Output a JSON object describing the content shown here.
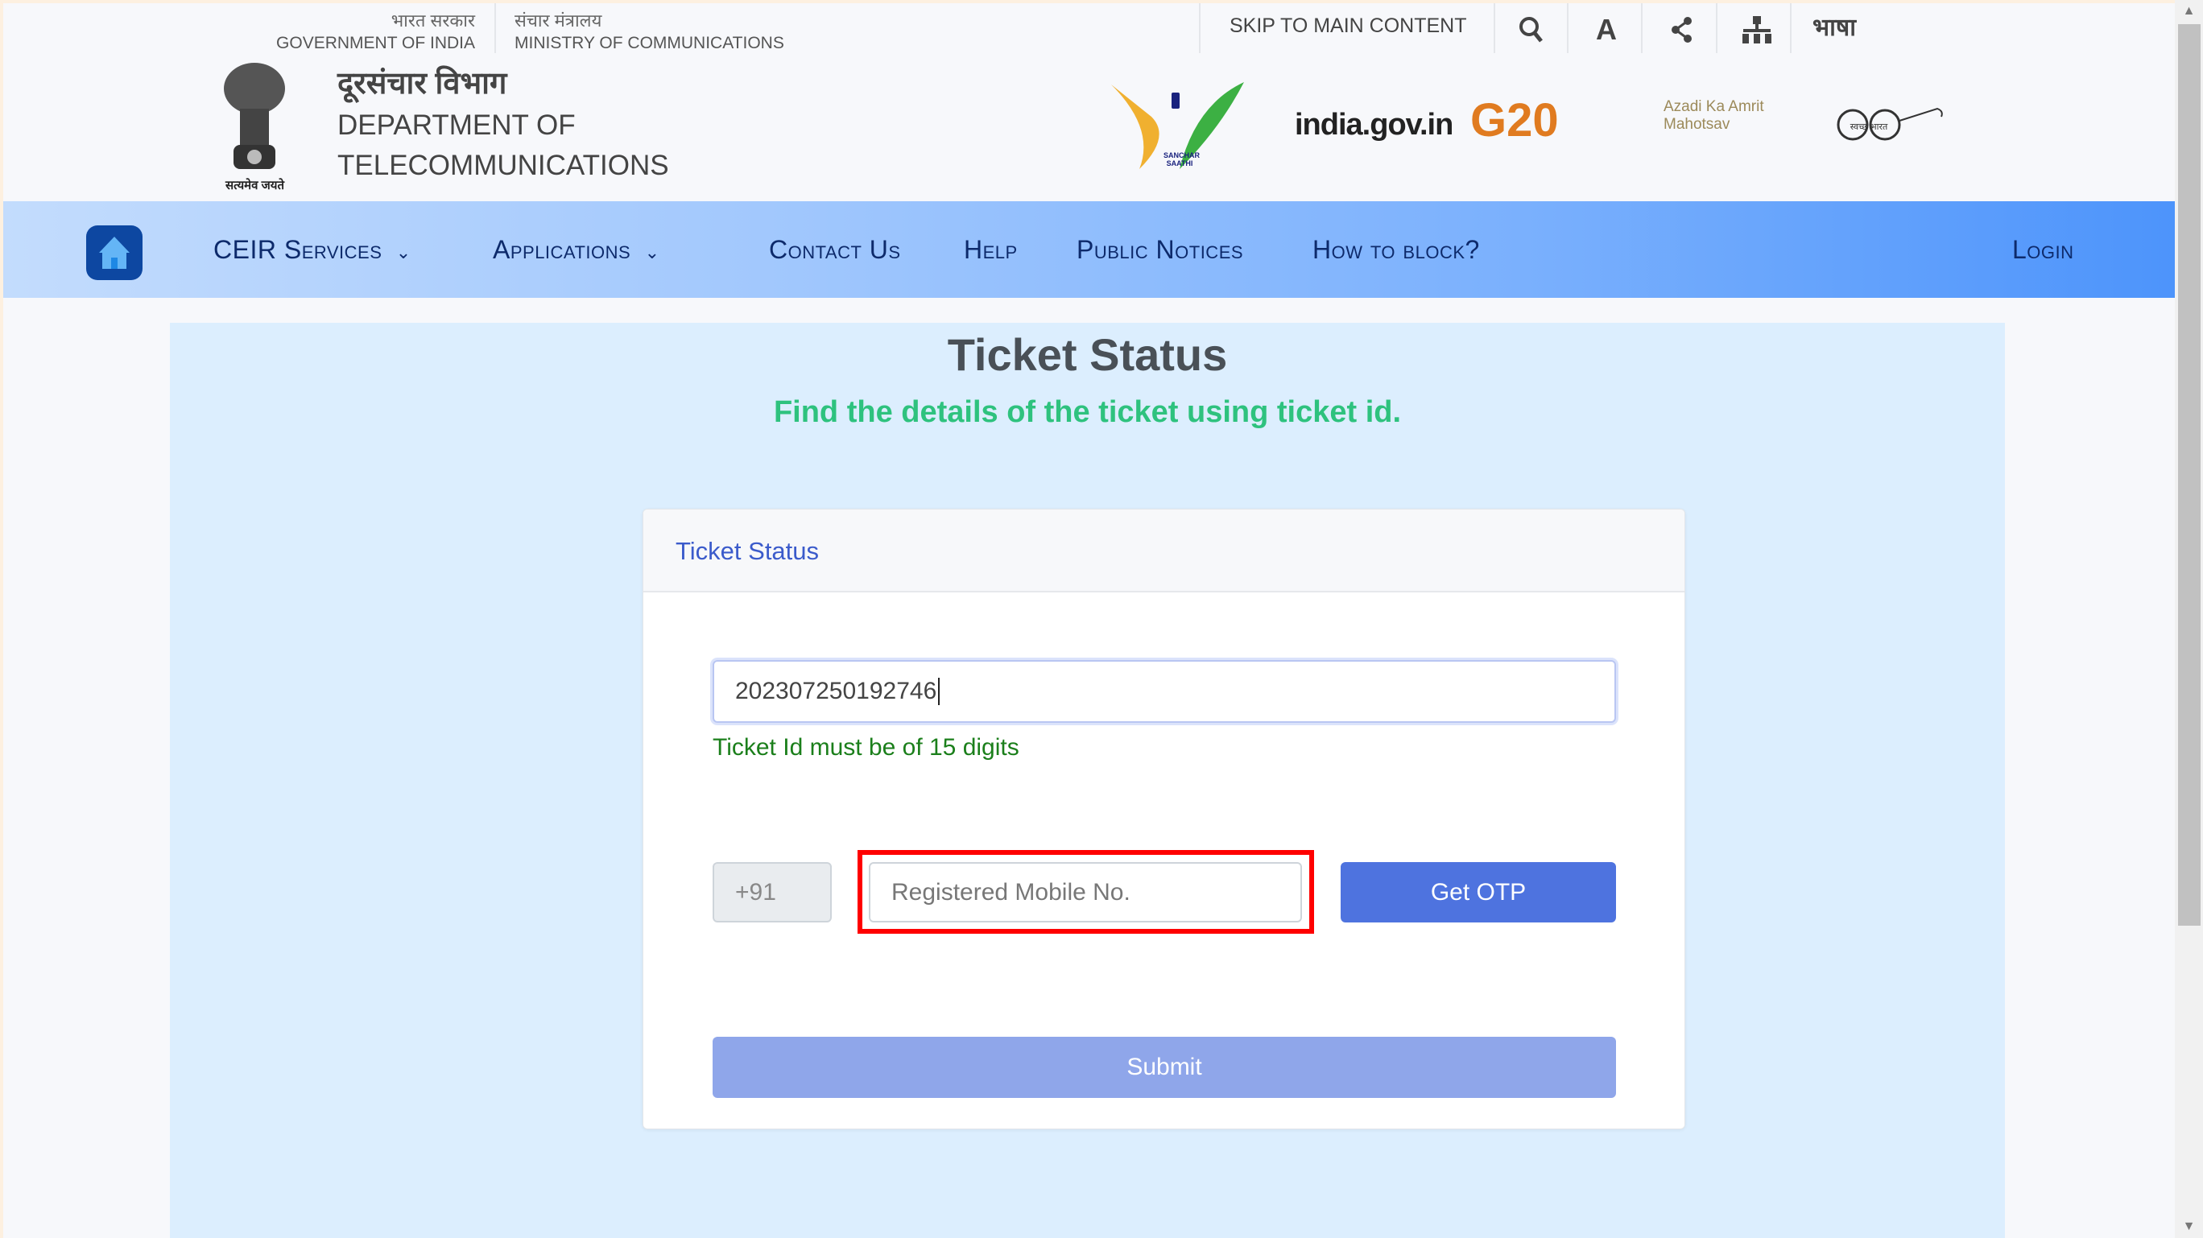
{
  "utility_bar": {
    "gov_hindi": "भारत सरकार",
    "gov_english": "GOVERNMENT OF INDIA",
    "ministry_hindi": "संचार मंत्रालय",
    "ministry_english": "MINISTRY OF COMMUNICATIONS",
    "skip_link": "SKIP TO MAIN CONTENT",
    "icons": [
      "search-icon",
      "font-size-icon",
      "share-icon",
      "sitemap-icon"
    ],
    "language": "भाषा"
  },
  "header": {
    "emblem_motto": "सत्यमेव जयते",
    "dept_hindi": "दूरसंचार विभाग",
    "dept_line1": "DEPARTMENT OF",
    "dept_line2": "TELECOMMUNICATIONS",
    "logos": {
      "sanchar": "SANCHAR SAATHI",
      "india_gov": "india.gov.in",
      "g20": "G20",
      "azadi": "Azadi Ka Amrit Mahotsav",
      "swachh": "स्वच्छ भारत"
    }
  },
  "nav": {
    "items": [
      {
        "label": "CEIR Services",
        "dropdown": true
      },
      {
        "label": "Applications",
        "dropdown": true
      },
      {
        "label": "Contact Us"
      },
      {
        "label": "Help"
      },
      {
        "label": "Public Notices"
      },
      {
        "label": "How to block?"
      }
    ],
    "login": "Login"
  },
  "main": {
    "title": "Ticket Status",
    "subtitle": "Find the details of the ticket using ticket id.",
    "card": {
      "header": "Ticket Status",
      "ticket_id_value": "202307250192746",
      "ticket_error": "Ticket Id must be of 15 digits",
      "country_code": "+91",
      "mobile_placeholder": "Registered Mobile No.",
      "get_otp": "Get OTP",
      "submit": "Submit"
    }
  },
  "colors": {
    "nav_gradient_end": "#4d94fb",
    "subtitle": "#2ec27e",
    "error": "#1b7f1b",
    "get_otp": "#4e73df",
    "submit": "#8fa6ea",
    "highlight": "#ff0000"
  }
}
